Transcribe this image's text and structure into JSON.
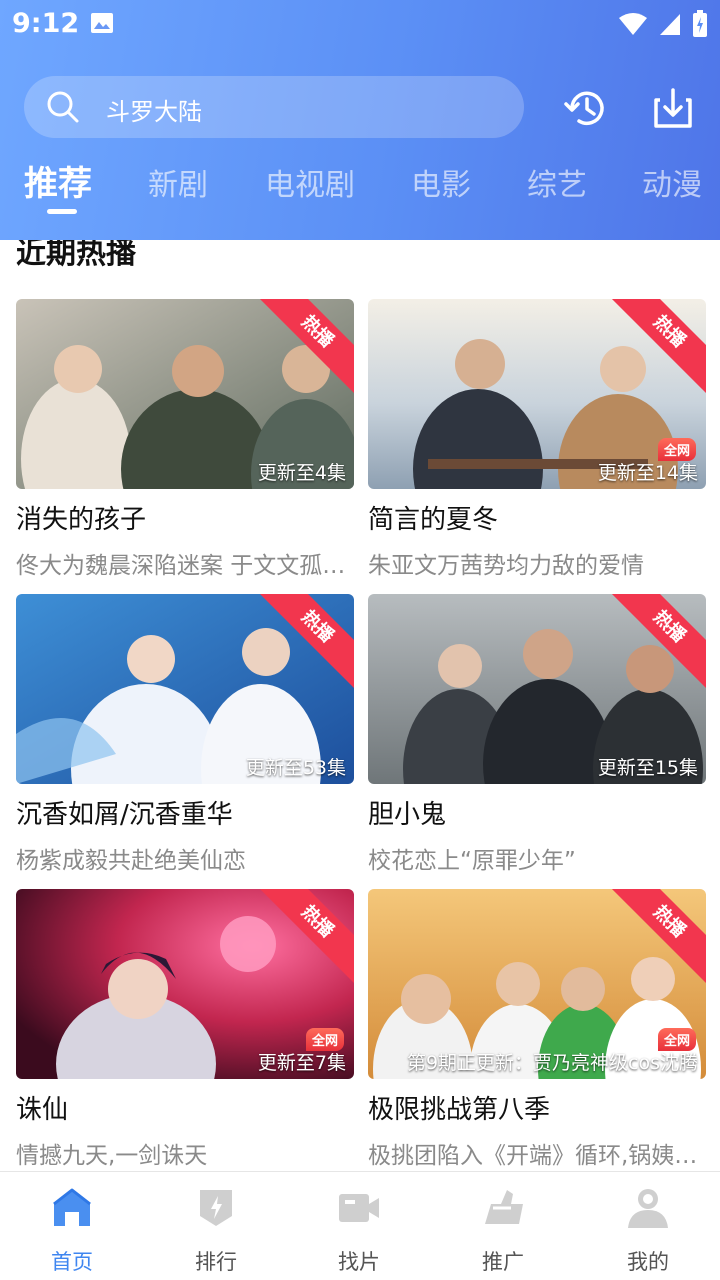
{
  "status": {
    "time": "9:12"
  },
  "search": {
    "text": "斗罗大陆"
  },
  "tabs": [
    "推荐",
    "新剧",
    "电视剧",
    "电影",
    "综艺",
    "动漫"
  ],
  "section": {
    "title": "近期热播"
  },
  "hot_badge": "热播",
  "quanwang_badge": "全网",
  "cards": [
    {
      "title": "消失的孩子",
      "desc": "佟大为魏晨深陷迷案 于文文孤…",
      "episode": "更新至4集"
    },
    {
      "title": "简言的夏冬",
      "desc": "朱亚文万茜势均力敌的爱情",
      "episode": "更新至14集"
    },
    {
      "title": "沉香如屑/沉香重华",
      "desc": "杨紫成毅共赴绝美仙恋",
      "episode": "更新至53集"
    },
    {
      "title": "胆小鬼",
      "desc": "校花恋上“原罪少年”",
      "episode": "更新至15集"
    },
    {
      "title": "诛仙",
      "desc": "情撼九天,一剑诛天",
      "episode": "更新至7集"
    },
    {
      "title": "极限挑战第八季",
      "desc": "极挑团陷入《开端》循环,锅姨…",
      "episode": "第9期正更新：贾乃亮神级cos沈腾"
    }
  ],
  "nav": [
    {
      "label": "首页",
      "icon": "home-icon"
    },
    {
      "label": "排行",
      "icon": "ranking-icon"
    },
    {
      "label": "找片",
      "icon": "video-camera-icon"
    },
    {
      "label": "推广",
      "icon": "thumbs-up-icon"
    },
    {
      "label": "我的",
      "icon": "user-icon"
    }
  ],
  "colors": {
    "header_start": "#6fa7ff",
    "header_end": "#4f75e8",
    "accent": "#3f86f0",
    "hot": "#f2364e"
  }
}
